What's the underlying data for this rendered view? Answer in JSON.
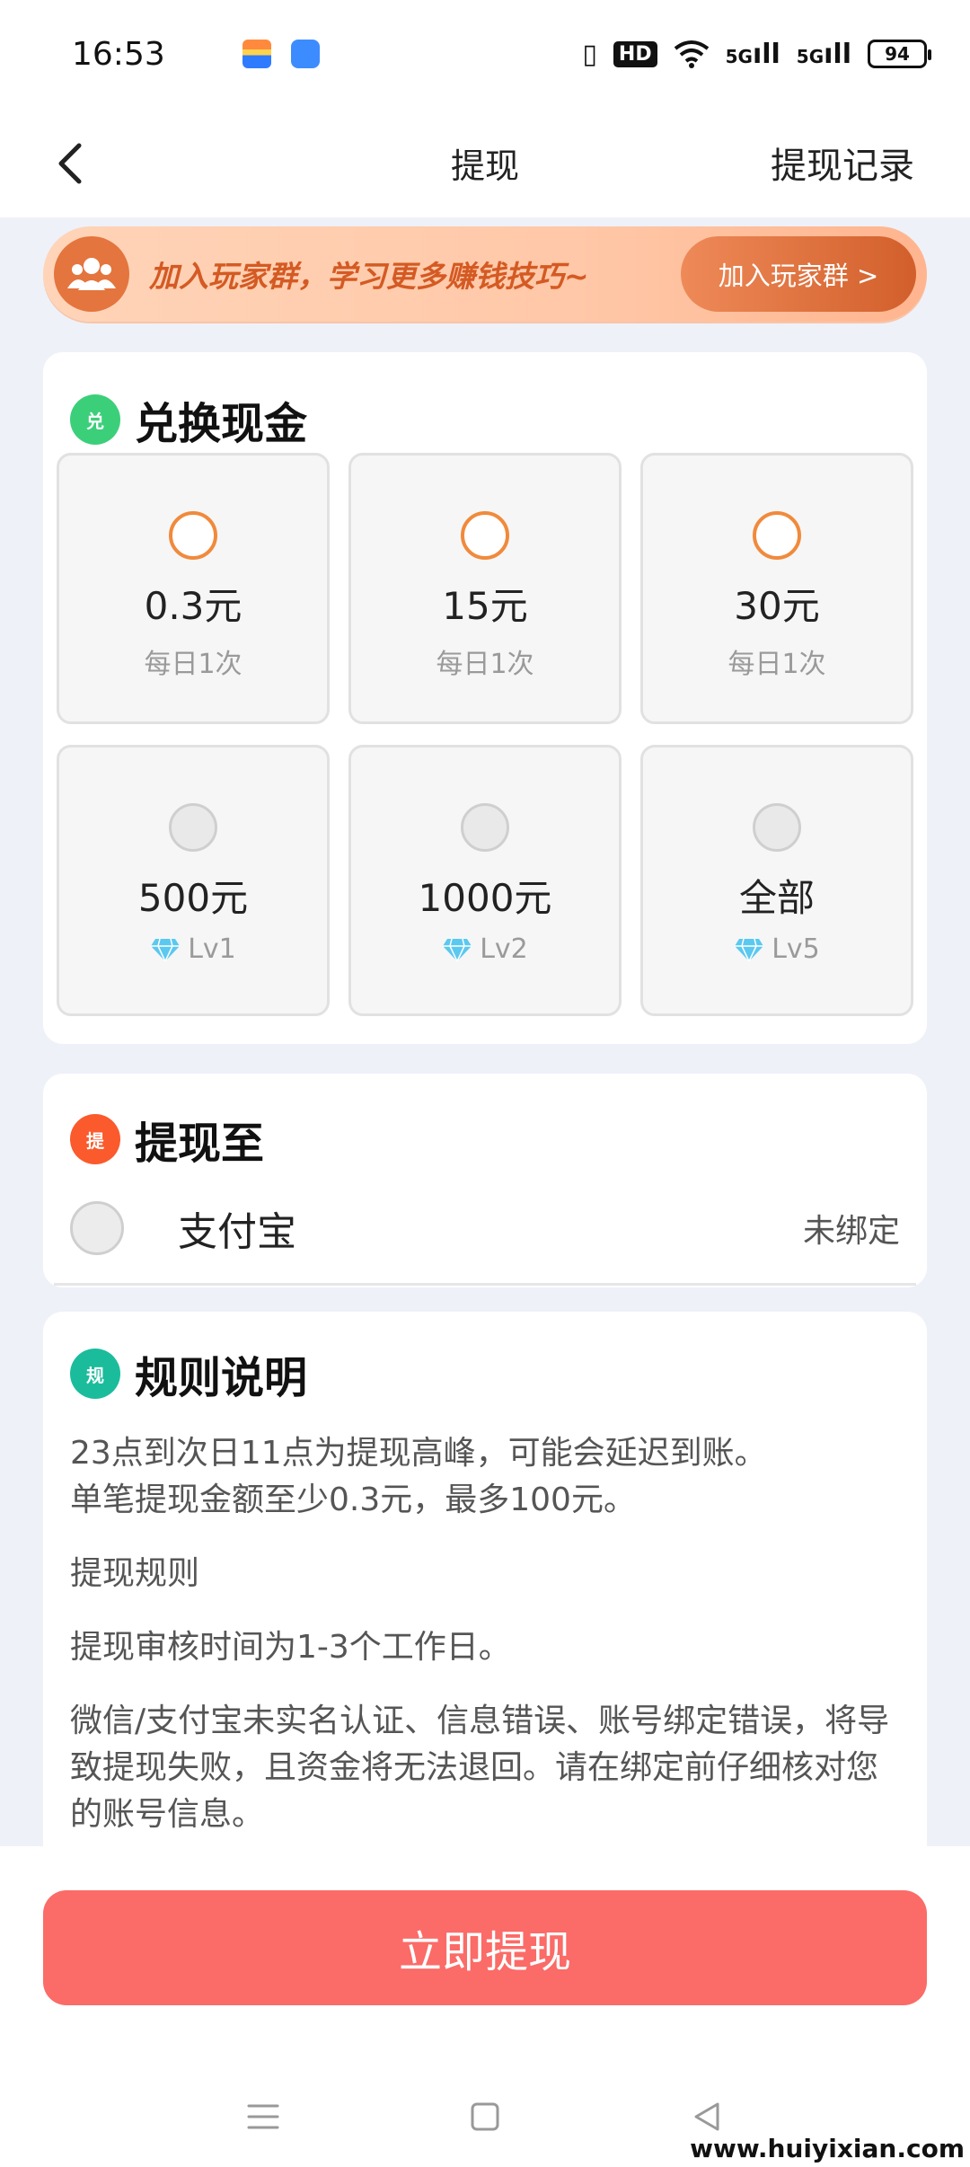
{
  "status_bar": {
    "time": "16:53",
    "icons": [
      "app-notification-icon",
      "app-notification-icon",
      "vibrate-icon",
      "hd-icon",
      "wifi-icon",
      "5g-signal-icon",
      "5g-signal-icon",
      "battery-icon"
    ],
    "hd_label": "HD",
    "net1": "5G",
    "net2": "5G",
    "battery": "94"
  },
  "header": {
    "title": "提现",
    "right_link": "提现记录"
  },
  "banner": {
    "text": "加入玩家群，学习更多赚钱技巧~",
    "button": "加入玩家群 >"
  },
  "exchange": {
    "badge": "兑",
    "title": "兑换现金",
    "options": [
      {
        "amount": "0.3元",
        "sub": "每日1次",
        "state": "available"
      },
      {
        "amount": "15元",
        "sub": "每日1次",
        "state": "available"
      },
      {
        "amount": "30元",
        "sub": "每日1次",
        "state": "available"
      },
      {
        "amount": "500元",
        "sub": "Lv1",
        "state": "locked"
      },
      {
        "amount": "1000元",
        "sub": "Lv2",
        "state": "locked"
      },
      {
        "amount": "全部",
        "sub": "Lv5",
        "state": "locked"
      }
    ]
  },
  "withdraw_to": {
    "badge": "提",
    "title": "提现至",
    "method": "支付宝",
    "status": "未绑定"
  },
  "rules": {
    "badge": "规",
    "title": "规则说明",
    "para1": "23点到次日11点为提现高峰，可能会延迟到账。",
    "para1b": "单笔提现金额至少0.3元，最多100元。",
    "para2": "提现规则",
    "para3": "提现审核时间为1-3个工作日。",
    "para4": "微信/支付宝未实名认证、信息错误、账号绑定错误，将导致提现失败，且资金将无法退回。请在绑定前仔细核对您的账号信息。"
  },
  "cta": "立即提现",
  "watermark": "www.huiyixian.com",
  "colors": {
    "accent": "#fb6b67",
    "radio_open": "#f08a3c",
    "badge_exchange": "#3ccf7a",
    "badge_withdraw": "#fa5a2c",
    "badge_rules": "#1abc9c",
    "banner_text": "#d45a23"
  }
}
